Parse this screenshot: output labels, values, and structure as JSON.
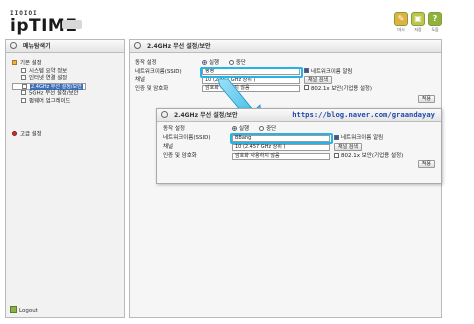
{
  "header": {
    "logo_dots": "IIOIOI",
    "logo_text": "ipTIME",
    "buttons": [
      {
        "label": "마시",
        "color": "#e0b340"
      },
      {
        "label": "저장",
        "color": "#b9c84a"
      },
      {
        "label": "도움",
        "color": "#8fb33a"
      }
    ]
  },
  "sidebar": {
    "title": "메뉴탐색기",
    "items": [
      {
        "label": "기본 설정",
        "level": 1,
        "icon": "folder-icon"
      },
      {
        "label": "시스템 요약 정보",
        "level": 2,
        "icon": "page-icon"
      },
      {
        "label": "인터넷 연결 설정",
        "level": 2,
        "icon": "page-icon"
      },
      {
        "label": "2.4GHz 무선 설정/보안",
        "level": 2,
        "icon": "page-icon",
        "selected": true
      },
      {
        "label": "5GHz 무선 설정/보안",
        "level": 2,
        "icon": "page-icon"
      },
      {
        "label": "펌웨어 업그레이드",
        "level": 2,
        "icon": "page-icon"
      }
    ],
    "advanced": {
      "label": "고급 설정"
    },
    "logout": "Logout"
  },
  "main": {
    "title": "2.4GHz 무선 설정/보안",
    "rows": {
      "operation": {
        "label": "동작 설정",
        "on": "실행",
        "off": "중단"
      },
      "ssid": {
        "label": "네트워크이름(SSID)",
        "value": "빵빵",
        "hide_label": "네트워크이름 알림"
      },
      "channel": {
        "label": "채널",
        "value": "10 (2.457 GHz 상위 )",
        "search": "채널 검색"
      },
      "auth": {
        "label": "인증 및 암호화",
        "value": "암호화 사용하지 않음",
        "dot1x": "802.1x 보안(기업용 설정)"
      },
      "apply": "적용"
    }
  },
  "zoom": {
    "title": "2.4GHz 무선 설정/보안",
    "blog": "https://blog.naver.com/graandayay",
    "rows": {
      "operation": {
        "label": "동작 설정",
        "on": "실행",
        "off": "중단"
      },
      "ssid": {
        "label": "네트워크이름(SSID)",
        "value": "BBang",
        "hide_label": "네트워크이름 알림"
      },
      "channel": {
        "label": "채널",
        "value": "10 (2.457 GHz 상위 )",
        "search": "채널 검색"
      },
      "auth": {
        "label": "인증 및 암호화",
        "value": "암호화 사용하지 않음",
        "dot1x": "802.1x 보안(기업용 설정)"
      },
      "apply": "적용"
    }
  },
  "colors": {
    "highlight": "#28b3e6",
    "selected": "#3d6fb8",
    "blog_link": "#1f4aa8"
  }
}
